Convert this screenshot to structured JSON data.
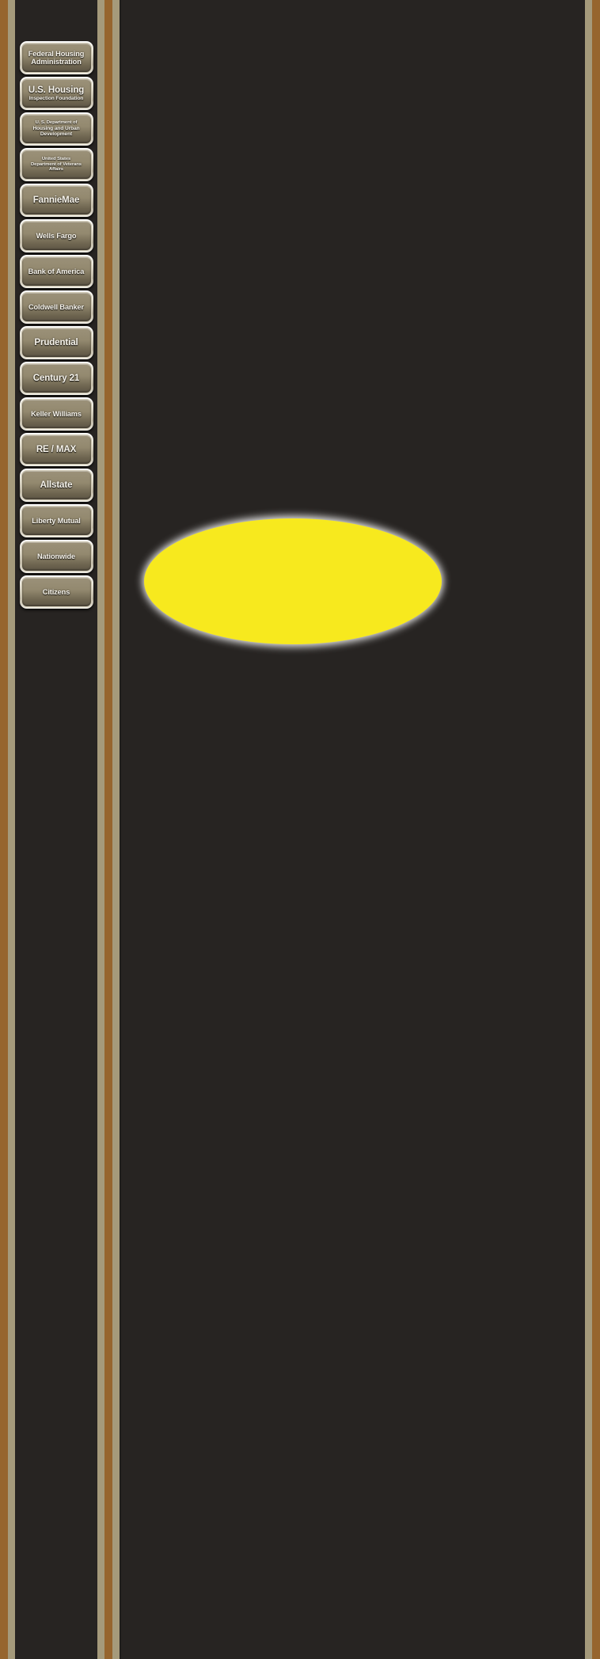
{
  "theme": {
    "background": "#272422",
    "frame_brown": "#96652e",
    "frame_tan": "#a59a7b",
    "button_face_top": "#9b9179",
    "button_face_bottom": "#5d5545",
    "button_bezel": "#e8e4d6",
    "button_text": "#f7f4ec",
    "accent_yellow": "#f7e91e",
    "ellipse_glow": "#ffffff"
  },
  "sidebar": {
    "items": [
      {
        "id": "federal-housing-administration",
        "lines": [
          {
            "text": "Federal Housing",
            "size": "md"
          },
          {
            "text": "Administration",
            "size": "md"
          }
        ]
      },
      {
        "id": "us-housing-inspection-foundation",
        "lines": [
          {
            "text": "U.S. Housing",
            "size": "lg"
          },
          {
            "text": "Inspection Foundation",
            "size": "sm"
          }
        ]
      },
      {
        "id": "us-department-of-housing-and-urban-development",
        "lines": [
          {
            "text": "U. S. Department of",
            "size": "xs"
          },
          {
            "text": "Housing and Urban",
            "size": "sm"
          },
          {
            "text": "Development",
            "size": "sm"
          }
        ]
      },
      {
        "id": "united-states-department-of-veterans-affairs",
        "lines": [
          {
            "text": "United States",
            "size": "xs"
          },
          {
            "text": "Department of Veterans",
            "size": "xs"
          },
          {
            "text": "Affairs",
            "size": "xs"
          }
        ]
      },
      {
        "id": "fanniemae",
        "lines": [
          {
            "text": "FannieMae",
            "size": "lg"
          }
        ]
      },
      {
        "id": "wells-fargo",
        "lines": [
          {
            "text": "Wells Fargo",
            "size": "md"
          }
        ]
      },
      {
        "id": "bank-of-america",
        "lines": [
          {
            "text": "Bank of America",
            "size": "md"
          }
        ]
      },
      {
        "id": "coldwell-banker",
        "lines": [
          {
            "text": "Coldwell Banker",
            "size": "md"
          }
        ]
      },
      {
        "id": "prudential",
        "lines": [
          {
            "text": "Prudential",
            "size": "lg"
          }
        ]
      },
      {
        "id": "century-21",
        "lines": [
          {
            "text": "Century 21",
            "size": "lg"
          }
        ]
      },
      {
        "id": "keller-williams",
        "lines": [
          {
            "text": "Keller Williams",
            "size": "md"
          }
        ]
      },
      {
        "id": "re-max",
        "lines": [
          {
            "text": "RE / MAX",
            "size": "lg"
          }
        ]
      },
      {
        "id": "allstate",
        "lines": [
          {
            "text": "Allstate",
            "size": "lg"
          }
        ]
      },
      {
        "id": "liberty-mutual",
        "lines": [
          {
            "text": "Liberty Mutual",
            "size": "md"
          }
        ]
      },
      {
        "id": "nationwide",
        "lines": [
          {
            "text": "Nationwide",
            "size": "md"
          }
        ]
      },
      {
        "id": "citizens",
        "lines": [
          {
            "text": "Citizens",
            "size": "md"
          }
        ]
      }
    ]
  },
  "main": {
    "shape": {
      "type": "ellipse",
      "fill": "#f7e91e",
      "glow": "#ffffff",
      "label": ""
    }
  }
}
